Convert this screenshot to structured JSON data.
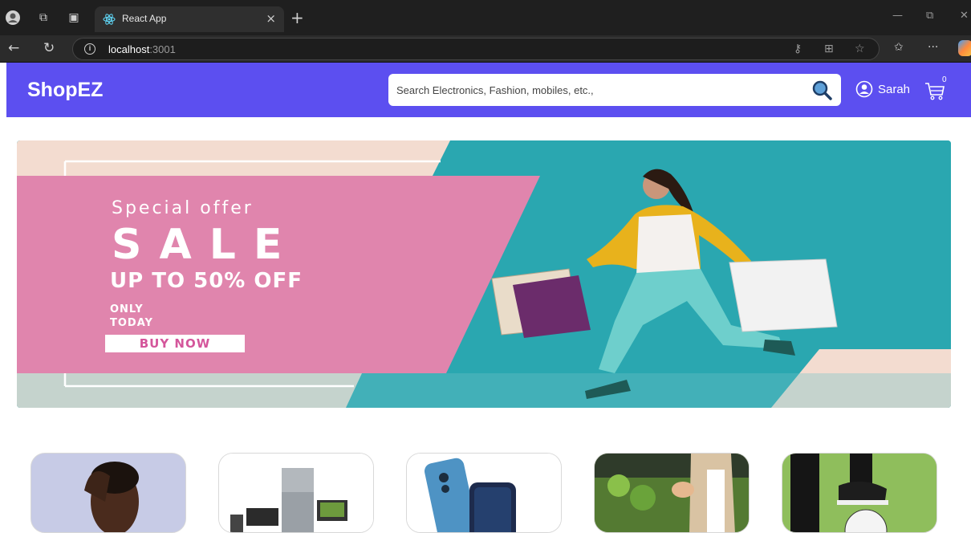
{
  "browser": {
    "tab_title": "React App",
    "url_host": "localhost",
    "url_port": ":3001",
    "icons": [
      "profile-icon",
      "workspaces-icon",
      "tab-actions-icon",
      "react-favicon",
      "close-tab-icon",
      "new-tab-icon",
      "minimize-icon",
      "restore-icon",
      "close-window-icon",
      "back-icon",
      "refresh-icon",
      "site-info-icon",
      "password-key-icon",
      "split-screen-icon",
      "favorite-star-icon",
      "favorites-icon",
      "more-icon",
      "copilot-icon"
    ]
  },
  "header": {
    "brand": "ShopEZ",
    "search_placeholder": "Search Electronics, Fashion, mobiles, etc.,",
    "user_name": "Sarah",
    "cart_count": "0",
    "accent_color": "#5c4ff0"
  },
  "banner": {
    "special": "Special offer",
    "sale": "SALE",
    "off": "UP TO 50% OFF",
    "only": "ONLY",
    "today": "TODAY",
    "cta": "BUY NOW",
    "colors": {
      "pink": "#e085ad",
      "teal": "#2aa7b0",
      "cream": "#f3dcd0"
    }
  },
  "categories": [
    {
      "image": "fashion-man-photo"
    },
    {
      "image": "electronics-appliances-photo"
    },
    {
      "image": "mobiles-photo"
    },
    {
      "image": "groceries-photo"
    },
    {
      "image": "sports-football-photo"
    }
  ]
}
